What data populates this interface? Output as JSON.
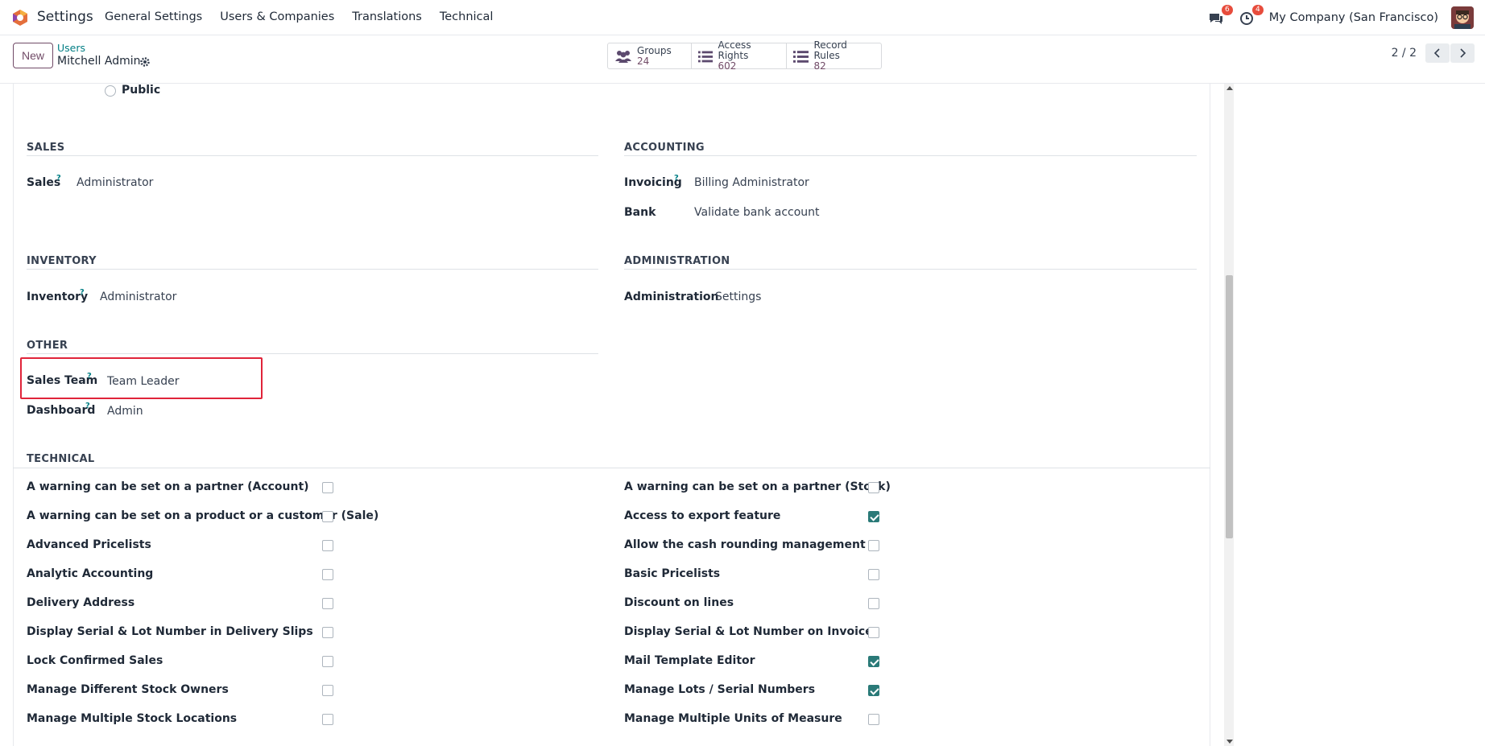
{
  "navbar": {
    "app_name": "Settings",
    "menu": [
      "General Settings",
      "Users & Companies",
      "Translations",
      "Technical"
    ],
    "messages_count": "6",
    "activities_count": "4",
    "company": "My Company (San Francisco)"
  },
  "control": {
    "new_label": "New",
    "breadcrumb_parent": "Users",
    "breadcrumb_current": "Mitchell Admin",
    "smart_buttons": [
      {
        "label": "Groups",
        "value": "24",
        "icon": "users-icon"
      },
      {
        "label": "Access Rights",
        "value": "602",
        "icon": "list-icon"
      },
      {
        "label": "Record Rules",
        "value": "82",
        "icon": "list-icon"
      }
    ],
    "pager": "2 / 2"
  },
  "form": {
    "public_option": "Public",
    "sections": {
      "sales": "SALES",
      "accounting": "ACCOUNTING",
      "inventory": "INVENTORY",
      "administration": "ADMINISTRATION",
      "other": "OTHER",
      "technical": "TECHNICAL"
    },
    "fields": {
      "sales_label": "Sales",
      "sales_value": "Administrator",
      "invoicing_label": "Invoicing",
      "invoicing_value": "Billing Administrator",
      "bank_label": "Bank",
      "bank_value": "Validate bank account",
      "inventory_label": "Inventory",
      "inventory_value": "Administrator",
      "administration_label": "Administration",
      "administration_value": "Settings",
      "sales_team_label": "Sales Team",
      "sales_team_value": "Team Leader",
      "dashboard_label": "Dashboard",
      "dashboard_value": "Admin",
      "help_mark": "?"
    },
    "technical_left": [
      {
        "label": "A warning can be set on a partner (Account)",
        "checked": false
      },
      {
        "label": "A warning can be set on a product or a customer (Sale)",
        "checked": false
      },
      {
        "label": "Advanced Pricelists",
        "checked": false
      },
      {
        "label": "Analytic Accounting",
        "checked": false
      },
      {
        "label": "Delivery Address",
        "checked": false
      },
      {
        "label": "Display Serial & Lot Number in Delivery Slips",
        "checked": false
      },
      {
        "label": "Lock Confirmed Sales",
        "checked": false
      },
      {
        "label": "Manage Different Stock Owners",
        "checked": false
      },
      {
        "label": "Manage Multiple Stock Locations",
        "checked": false
      }
    ],
    "technical_right": [
      {
        "label": "A warning can be set on a partner (Stock)",
        "checked": false
      },
      {
        "label": "Access to export feature",
        "checked": true
      },
      {
        "label": "Allow the cash rounding management",
        "checked": false
      },
      {
        "label": "Basic Pricelists",
        "checked": false
      },
      {
        "label": "Discount on lines",
        "checked": false
      },
      {
        "label": "Display Serial & Lot Number on Invoices",
        "checked": false
      },
      {
        "label": "Mail Template Editor",
        "checked": true
      },
      {
        "label": "Manage Lots / Serial Numbers",
        "checked": true
      },
      {
        "label": "Manage Multiple Units of Measure",
        "checked": false
      }
    ]
  }
}
